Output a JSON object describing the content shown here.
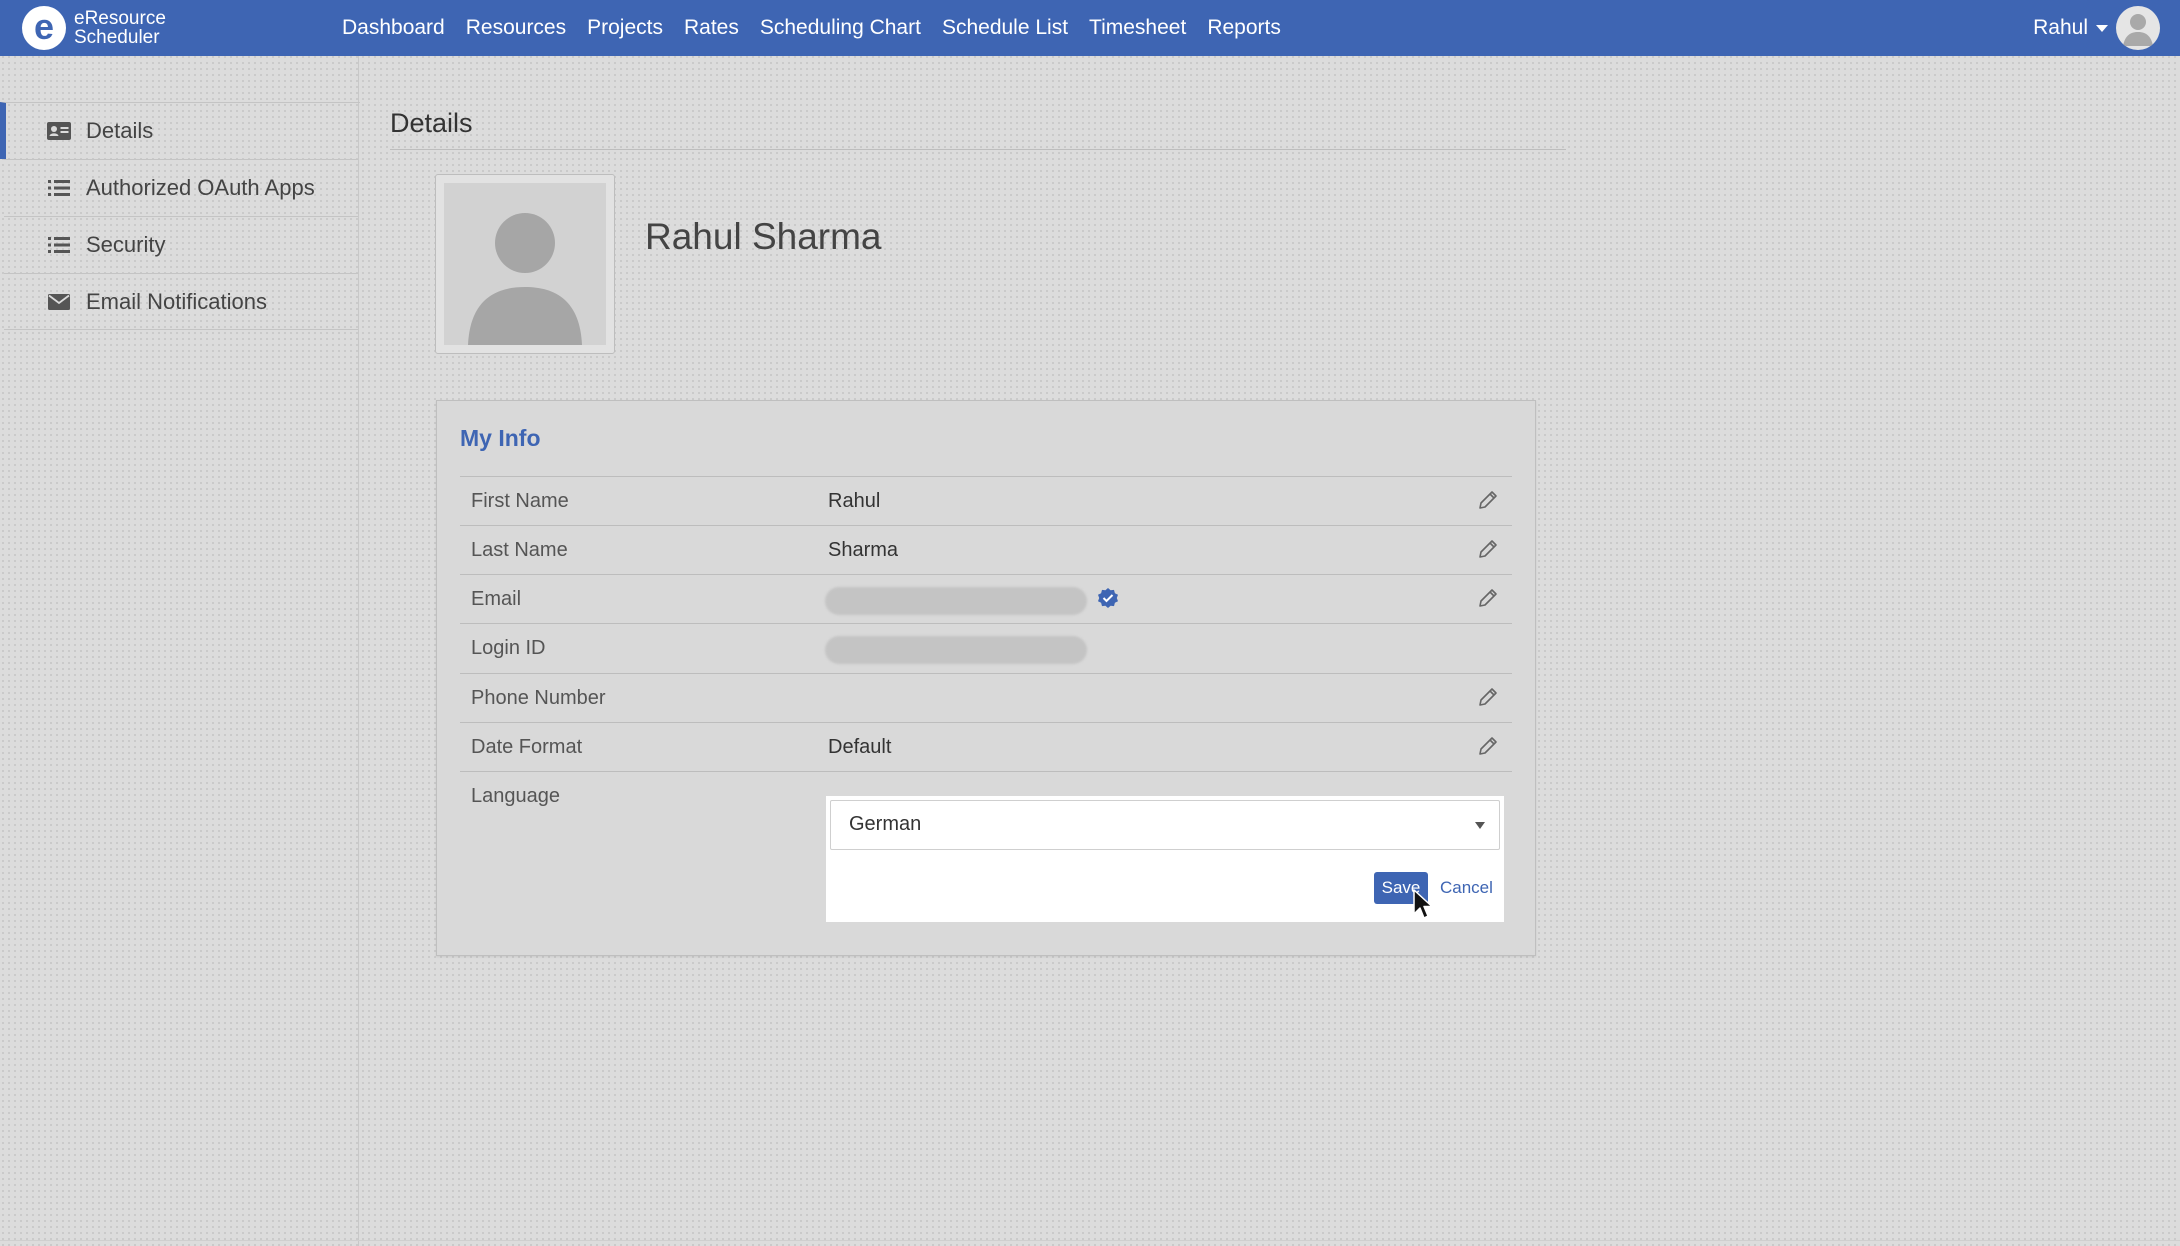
{
  "app": {
    "logo_letter": "e",
    "logo_line1": "eResource",
    "logo_line2": "Scheduler"
  },
  "nav": {
    "items": [
      "Dashboard",
      "Resources",
      "Projects",
      "Rates",
      "Scheduling Chart",
      "Schedule List",
      "Timesheet",
      "Reports"
    ]
  },
  "user": {
    "name": "Rahul",
    "icon": "avatar-icon"
  },
  "sidebar": {
    "items": [
      {
        "label": "Details",
        "icon": "id-card-icon",
        "active": true
      },
      {
        "label": "Authorized OAuth Apps",
        "icon": "list-icon",
        "active": false
      },
      {
        "label": "Security",
        "icon": "list-icon",
        "active": false
      },
      {
        "label": "Email Notifications",
        "icon": "envelope-icon",
        "active": false
      }
    ]
  },
  "page": {
    "title": "Details",
    "profile_name": "Rahul Sharma"
  },
  "my_info": {
    "title": "My Info",
    "rows": [
      {
        "label": "First Name",
        "value": "Rahul",
        "editable": true
      },
      {
        "label": "Last Name",
        "value": "Sharma",
        "editable": true
      },
      {
        "label": "Email",
        "value": "",
        "editable": true,
        "redacted": true,
        "verified": true
      },
      {
        "label": "Login ID",
        "value": "",
        "editable": false,
        "redacted": true
      },
      {
        "label": "Phone Number",
        "value": "",
        "editable": true
      },
      {
        "label": "Date Format",
        "value": "Default",
        "editable": true
      }
    ],
    "language": {
      "label": "Language",
      "selected": "German",
      "save_label": "Save",
      "cancel_label": "Cancel"
    }
  },
  "colors": {
    "brand": "#3e65b3",
    "background": "#dcdcdc",
    "card": "#d9d9d9"
  }
}
